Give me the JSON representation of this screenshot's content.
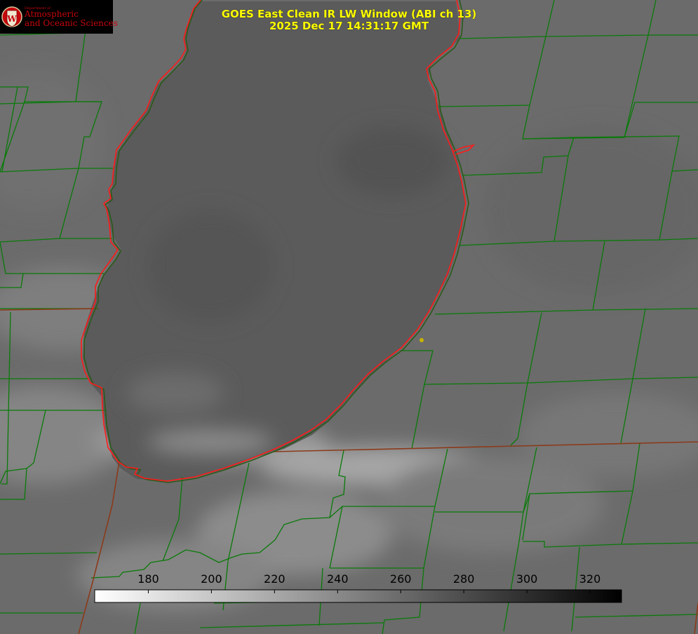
{
  "logo": {
    "department": "Department of",
    "line1": "Atmospheric",
    "line2": "and Oceanic Sciences",
    "seal_letter": "W"
  },
  "title": {
    "line1": "GOES East Clean IR LW Window (ABI ch 13)",
    "line2": "2025 Dec 17 14:31:17 GMT"
  },
  "colorbar": {
    "min": 163,
    "max": 330,
    "ticks": [
      180,
      200,
      220,
      240,
      260,
      280,
      300,
      320
    ],
    "gradient": "white-to-black"
  },
  "colors": {
    "background": "#6b6b6b",
    "lake_fill": "#5a5a5a",
    "county_lines": "#0a7a0a",
    "lake_outline": "#ff2020",
    "state_lines": "#8b3a1a",
    "title_text": "#ffff00",
    "logo_text": "#c5050c",
    "marker": "#c8b400"
  },
  "map": {
    "feature": "Lake Michigan (southern)",
    "marker": "yellow-dot"
  }
}
